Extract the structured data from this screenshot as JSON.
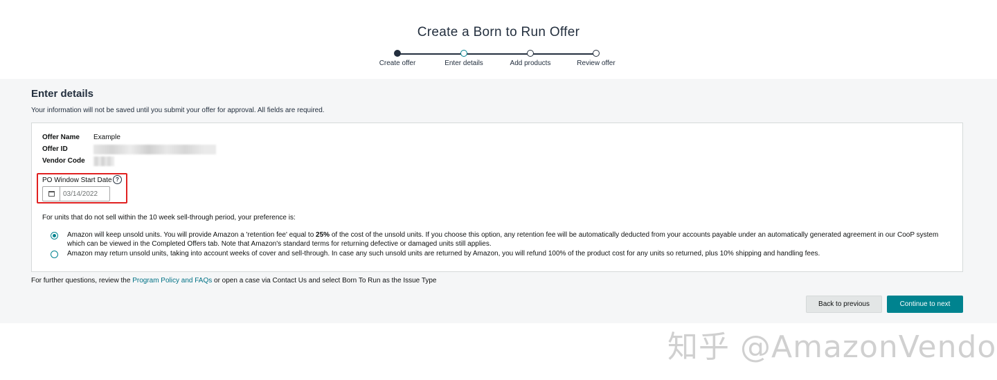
{
  "page": {
    "title": "Create a Born to Run Offer"
  },
  "stepper": {
    "steps": [
      {
        "label": "Create offer",
        "state": "complete"
      },
      {
        "label": "Enter details",
        "state": "current"
      },
      {
        "label": "Add products",
        "state": "upcoming"
      },
      {
        "label": "Review offer",
        "state": "upcoming"
      }
    ]
  },
  "details": {
    "heading": "Enter details",
    "subtitle": "Your information will not be saved until you submit your offer for approval. All fields are required.",
    "offer_name_label": "Offer Name",
    "offer_name_value": "Example",
    "offer_id_label": "Offer ID",
    "vendor_code_label": "Vendor Code",
    "po_window_label": "PO Window Start Date",
    "po_window_date": "03/14/2022",
    "preference_question": "For units that do not sell within the 10 week sell-through period, your preference is:",
    "options": [
      {
        "text_before": "Amazon will keep unsold units. You will provide Amazon a 'retention fee' equal to ",
        "bold": "25%",
        "text_after": " of the cost of the unsold units. If you choose this option, any retention fee will be automatically deducted from your accounts payable under an automatically generated agreement in our CooP system which can be viewed in the Completed Offers tab. Note that Amazon's standard terms for returning defective or damaged units still applies.",
        "selected": true
      },
      {
        "text": "Amazon may return unsold units, taking into account weeks of cover and sell-through. In case any such unsold units are returned by Amazon, you will refund 100% of the product cost for any units so returned, plus 10% shipping and handling fees.",
        "selected": false
      }
    ]
  },
  "footer": {
    "prefix": "For further questions, review the ",
    "link": "Program Policy and FAQs",
    "suffix": " or open a case via Contact Us and select Born To Run as the Issue Type"
  },
  "actions": {
    "back": "Back to previous",
    "next": "Continue to next"
  },
  "watermark": "知乎 @AmazonVendor",
  "colors": {
    "accent": "#00838f",
    "highlight": "#e02020",
    "navy": "#232f3e"
  }
}
